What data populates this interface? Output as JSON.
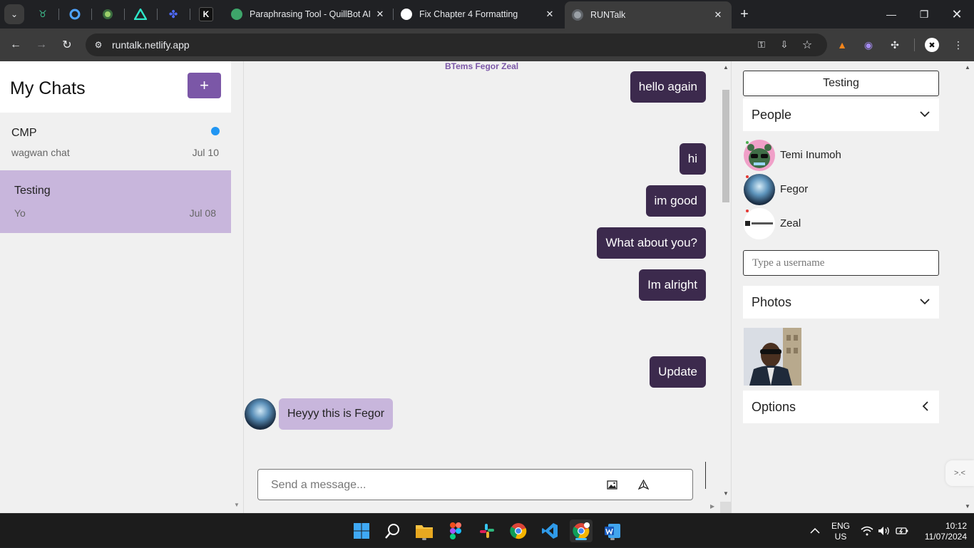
{
  "browser": {
    "tabs": [
      {
        "title": "Paraphrasing Tool - QuillBot AI",
        "close": "✕"
      },
      {
        "title": "Fix Chapter 4 Formatting",
        "close": "✕"
      },
      {
        "title": "RUNTalk",
        "close": "✕"
      }
    ],
    "new_tab": "+",
    "url": "runtalk.netlify.app"
  },
  "chat_list": {
    "title": "My Chats",
    "add_label": "+",
    "items": [
      {
        "name": "CMP",
        "preview": "wagwan chat",
        "date": "Jul 10",
        "unread": true
      },
      {
        "name": "Testing",
        "preview": "Yo",
        "date": "Jul 08",
        "unread": false
      }
    ]
  },
  "chat": {
    "members": "BTems Fegor Zeal",
    "messages": [
      {
        "text": "hello again",
        "from": "me"
      },
      {
        "text": "hi",
        "from": "me"
      },
      {
        "text": "im good",
        "from": "me"
      },
      {
        "text": "What about you?",
        "from": "me"
      },
      {
        "text": "Im alright",
        "from": "me"
      },
      {
        "text": "Update",
        "from": "me"
      },
      {
        "text": "Heyyy this is Fegor",
        "from": "Fegor"
      }
    ],
    "composer_placeholder": "Send a message..."
  },
  "details": {
    "chat_title": "Testing",
    "people_label": "People",
    "people": [
      {
        "name": "Temi Inumoh",
        "status_color": "#4caf50"
      },
      {
        "name": "Fegor",
        "status_color": "#e53935"
      },
      {
        "name": "Zeal",
        "status_color": "#e53935"
      }
    ],
    "username_placeholder": "Type a username",
    "photos_label": "Photos",
    "options_label": "Options"
  },
  "taskbar": {
    "lang_top": "ENG",
    "lang_bottom": "US",
    "time": "10:12",
    "date": "11/07/2024"
  },
  "colors": {
    "accent": "#7b57a7",
    "bubble_out": "#3c2a4d",
    "bubble_in": "#c8b6dc",
    "unread_dot": "#2196f3"
  }
}
